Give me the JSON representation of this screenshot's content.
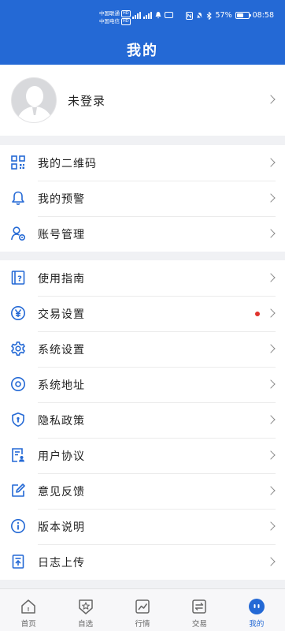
{
  "status_bar": {
    "carrier1": "中国联通",
    "carrier2": "中国电信",
    "hd": "HD",
    "battery": "57%",
    "battery_level": 0.57,
    "time": "08:58"
  },
  "header": {
    "title": "我的"
  },
  "profile": {
    "label": "未登录"
  },
  "menu_group1": [
    {
      "label": "我的二维码",
      "icon": "qr-code-icon"
    },
    {
      "label": "我的预警",
      "icon": "bell-icon"
    },
    {
      "label": "账号管理",
      "icon": "account-icon"
    }
  ],
  "menu_group2": [
    {
      "label": "使用指南",
      "icon": "guide-icon"
    },
    {
      "label": "交易设置",
      "icon": "yen-icon",
      "badge": true
    },
    {
      "label": "系统设置",
      "icon": "gear-icon"
    },
    {
      "label": "系统地址",
      "icon": "location-icon"
    },
    {
      "label": "隐私政策",
      "icon": "shield-icon"
    },
    {
      "label": "用户协议",
      "icon": "agreement-icon"
    },
    {
      "label": "意见反馈",
      "icon": "feedback-icon"
    },
    {
      "label": "版本说明",
      "icon": "info-icon"
    },
    {
      "label": "日志上传",
      "icon": "upload-log-icon"
    }
  ],
  "tabs": [
    {
      "label": "首页",
      "icon": "home-icon"
    },
    {
      "label": "自选",
      "icon": "watchlist-icon"
    },
    {
      "label": "行情",
      "icon": "market-icon"
    },
    {
      "label": "交易",
      "icon": "trade-icon"
    },
    {
      "label": "我的",
      "icon": "profile-icon",
      "active": true
    }
  ],
  "colors": {
    "brand": "#2469d5",
    "badge": "#e0322c"
  }
}
